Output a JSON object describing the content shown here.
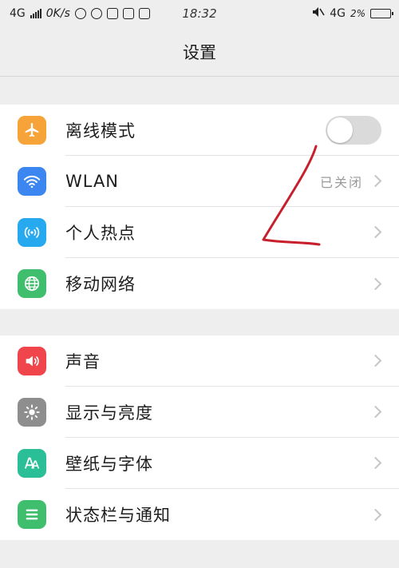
{
  "status_bar": {
    "network_left": "4G",
    "speed": "0K/s",
    "time": "18:32",
    "network_right": "4G",
    "battery": "2%",
    "icons": [
      "signal-icon",
      "qq-icon",
      "weibo-icon",
      "bookmark-icon",
      "s-app-icon",
      "db-icon",
      "mute-icon",
      "battery-icon"
    ]
  },
  "header": {
    "title": "设置"
  },
  "groups": [
    {
      "items": [
        {
          "label": "离线模式",
          "icon": "airplane-icon",
          "color": "#f6a33a",
          "control": "toggle",
          "toggle_on": false
        },
        {
          "label": "WLAN",
          "icon": "wifi-icon",
          "color": "#3b86f0",
          "value": "已关闭"
        },
        {
          "label": "个人热点",
          "icon": "hotspot-icon",
          "color": "#27a9f0"
        },
        {
          "label": "移动网络",
          "icon": "globe-icon",
          "color": "#3fbf6e"
        }
      ]
    },
    {
      "items": [
        {
          "label": "声音",
          "icon": "speaker-icon",
          "color": "#f0454a"
        },
        {
          "label": "显示与亮度",
          "icon": "brightness-icon",
          "color": "#8e8e8e"
        },
        {
          "label": "壁纸与字体",
          "icon": "font-icon",
          "color": "#2bbf97"
        },
        {
          "label": "状态栏与通知",
          "icon": "statusbar-icon",
          "color": "#3fbf6e"
        }
      ]
    }
  ],
  "annotation_color": "#c81f2c"
}
